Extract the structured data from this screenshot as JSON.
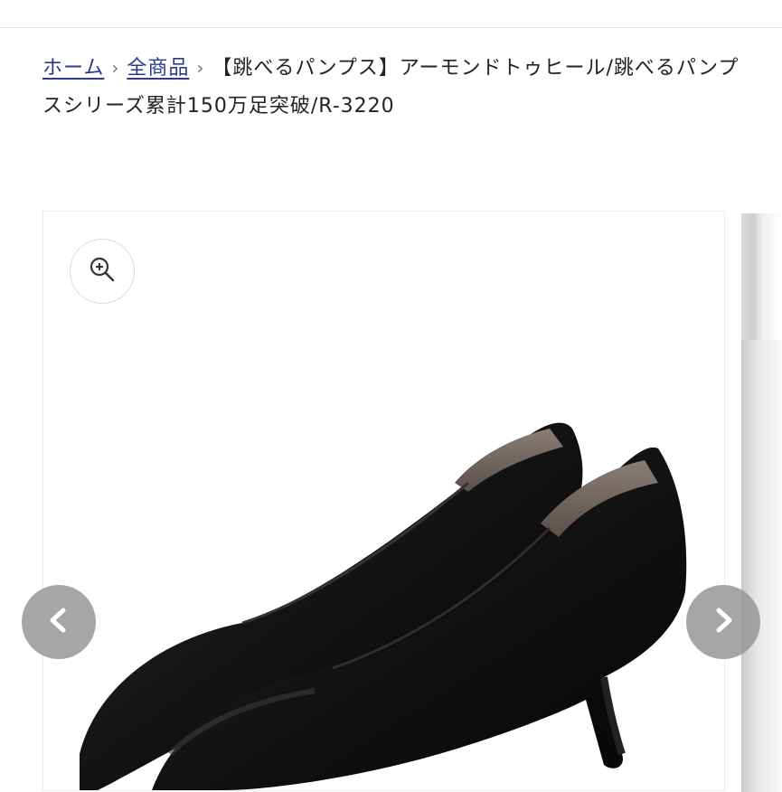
{
  "breadcrumb": {
    "home": "ホーム",
    "all_products": "全商品",
    "separator": "›",
    "current": "【跳べるパンプス】アーモンドトゥヒール/跳べるパンプスシリーズ累計150万足突破/R-3220"
  },
  "gallery": {
    "zoom_icon": "zoom-in-icon",
    "prev_icon": "chevron-left-icon",
    "next_icon": "chevron-right-icon",
    "product_image": "black leather almond-toe pumps"
  },
  "colors": {
    "link": "#2b3a8f",
    "nav_button": "#969696",
    "shoe": "#151515"
  }
}
